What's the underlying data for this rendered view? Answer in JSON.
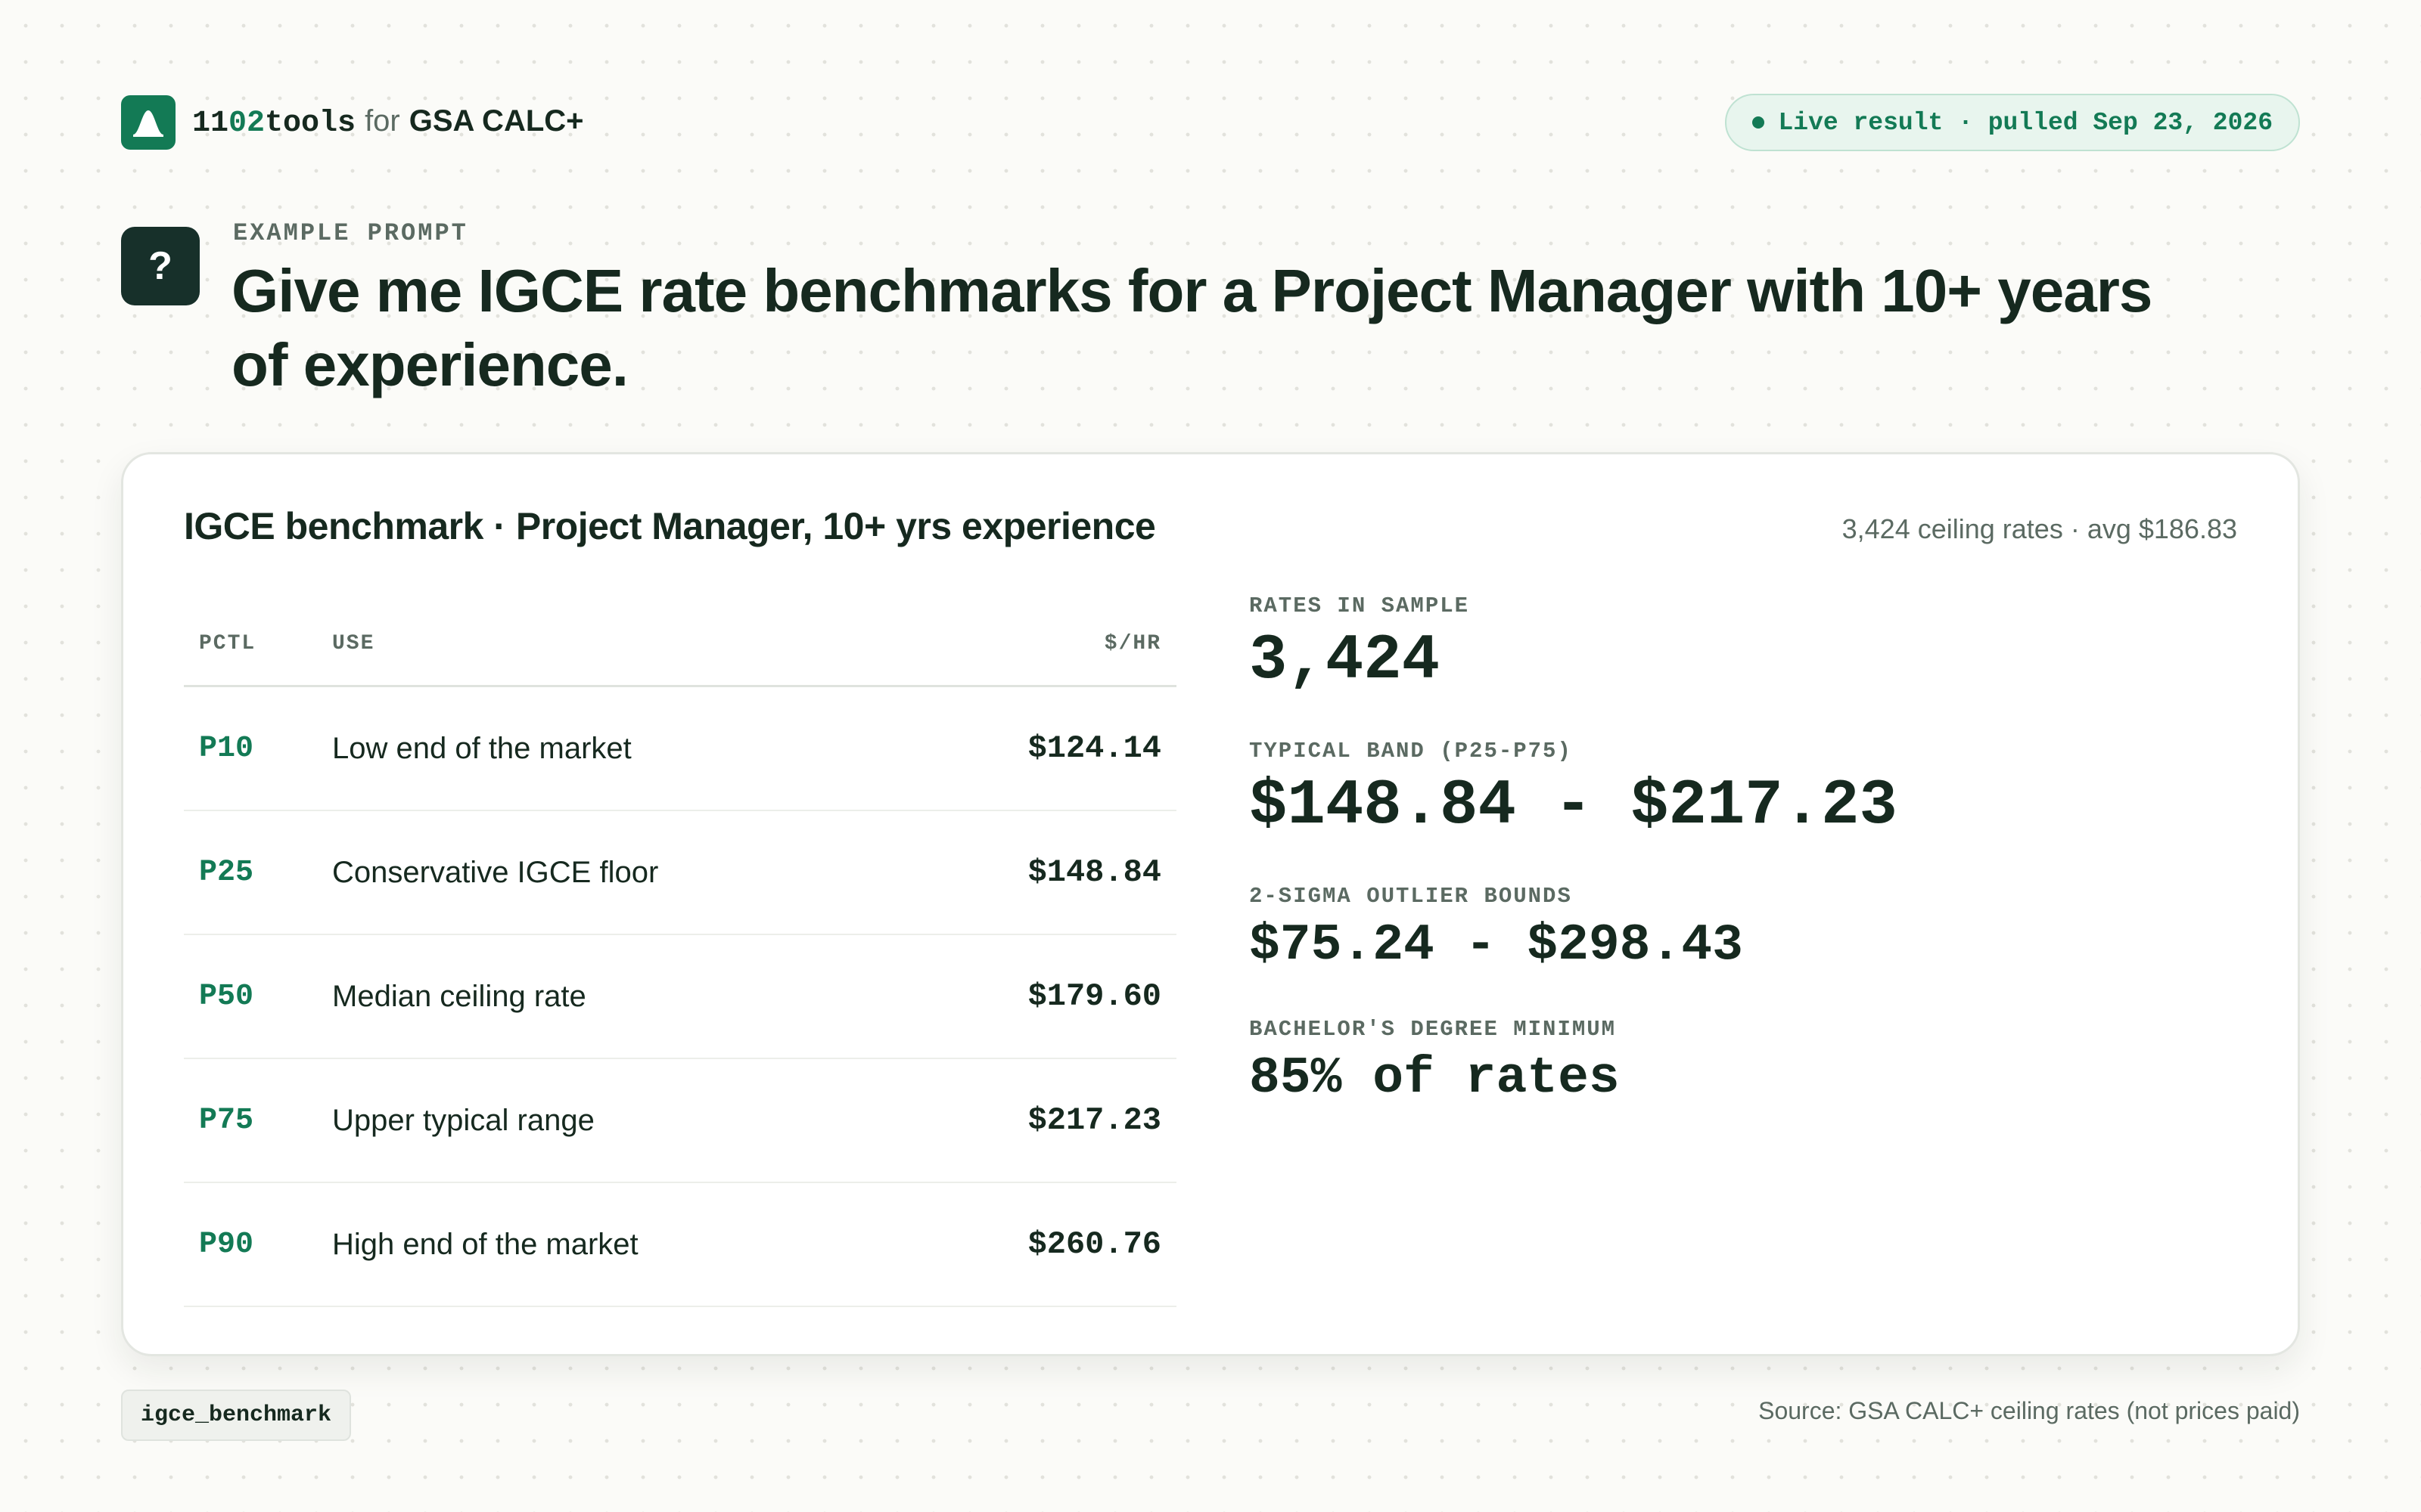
{
  "brand": {
    "name_prefix": "11",
    "name_accent": "02",
    "name_suffix": "tools",
    "for": "for",
    "product": "GSA CALC+"
  },
  "status": {
    "label": "Live result · pulled Sep 23, 2026",
    "color": "#137a55"
  },
  "prompt": {
    "icon": "question-mark",
    "icon_glyph": "?",
    "label": "EXAMPLE PROMPT",
    "text": "Give me IGCE rate benchmarks for a Project Manager with 10+ years of experience."
  },
  "card": {
    "title": "IGCE benchmark · Project Manager, 10+ yrs experience",
    "meta": "3,424 ceiling rates · avg $186.83",
    "table": {
      "headers": {
        "pctl": "PCTL",
        "use": "USE",
        "rate": "$/HR"
      },
      "rows": [
        {
          "pctl": "P10",
          "use": "Low end of the market",
          "rate": "$124.14"
        },
        {
          "pctl": "P25",
          "use": "Conservative IGCE floor",
          "rate": "$148.84"
        },
        {
          "pctl": "P50",
          "use": "Median ceiling rate",
          "rate": "$179.60"
        },
        {
          "pctl": "P75",
          "use": "Upper typical range",
          "rate": "$217.23"
        },
        {
          "pctl": "P90",
          "use": "High end of the market",
          "rate": "$260.76"
        }
      ]
    },
    "stats": [
      {
        "label": "RATES IN SAMPLE",
        "value": "3,424"
      },
      {
        "label": "TYPICAL BAND (P25-P75)",
        "value": "$148.84 - $217.23"
      },
      {
        "label": "2-SIGMA OUTLIER BOUNDS",
        "value": "$75.24 - $298.43"
      },
      {
        "label": "BACHELOR'S DEGREE MINIMUM",
        "value": "85% of rates"
      }
    ]
  },
  "footer": {
    "tool_name": "igce_benchmark",
    "source": "Source: GSA CALC+ ceiling rates (not prices paid)"
  },
  "colors": {
    "accent": "#137a55",
    "text": "#16291f",
    "muted": "#5b6a62"
  }
}
